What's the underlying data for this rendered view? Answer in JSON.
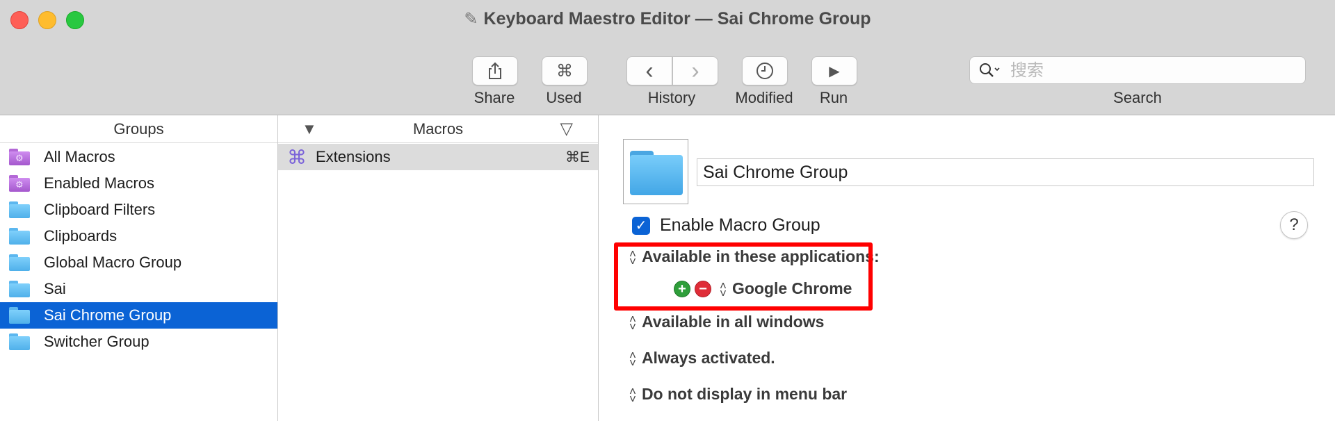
{
  "window": {
    "title": "Keyboard Maestro Editor — Sai Chrome Group"
  },
  "toolbar": {
    "share": {
      "label": "Share",
      "icon": "share-icon"
    },
    "used": {
      "label": "Used",
      "icon": "command-icon",
      "glyph": "⌘"
    },
    "history": {
      "label": "History",
      "back_glyph": "‹",
      "forward_glyph": "›"
    },
    "modified": {
      "label": "Modified",
      "icon": "clock-icon"
    },
    "run": {
      "label": "Run",
      "glyph": "▶"
    },
    "search": {
      "label": "Search",
      "placeholder": "搜索",
      "value": ""
    }
  },
  "groups": {
    "header": "Groups",
    "items": [
      {
        "label": "All Macros",
        "icon": "smart-folder-icon",
        "color": "purple"
      },
      {
        "label": "Enabled Macros",
        "icon": "smart-folder-icon",
        "color": "purple"
      },
      {
        "label": "Clipboard Filters",
        "icon": "folder-icon",
        "color": "blue"
      },
      {
        "label": "Clipboards",
        "icon": "folder-icon",
        "color": "blue"
      },
      {
        "label": "Global Macro Group",
        "icon": "folder-icon",
        "color": "blue"
      },
      {
        "label": "Sai",
        "icon": "folder-icon",
        "color": "blue"
      },
      {
        "label": "Sai Chrome Group",
        "icon": "folder-icon",
        "color": "blue",
        "selected": true
      },
      {
        "label": "Switcher Group",
        "icon": "folder-icon",
        "color": "blue"
      }
    ]
  },
  "macros": {
    "header": "Macros",
    "sort_glyph": "▼",
    "filter_glyph": "▽",
    "items": [
      {
        "label": "Extensions",
        "shortcut": "⌘E",
        "icon_glyph": "⌘"
      }
    ]
  },
  "detail": {
    "group_name": "Sai Chrome Group",
    "enable_label": "Enable Macro Group",
    "enabled": true,
    "help_glyph": "?",
    "availability_apps": "Available in these applications:",
    "app_name": "Google Chrome",
    "availability_windows": "Available in all windows",
    "activation": "Always activated.",
    "menu_bar": "Do not display in menu bar",
    "updown_glyph": "⌃⌄"
  },
  "colors": {
    "selection": "#0b63d5",
    "highlight": "#ff0000",
    "window_chrome": "#d6d6d6"
  }
}
